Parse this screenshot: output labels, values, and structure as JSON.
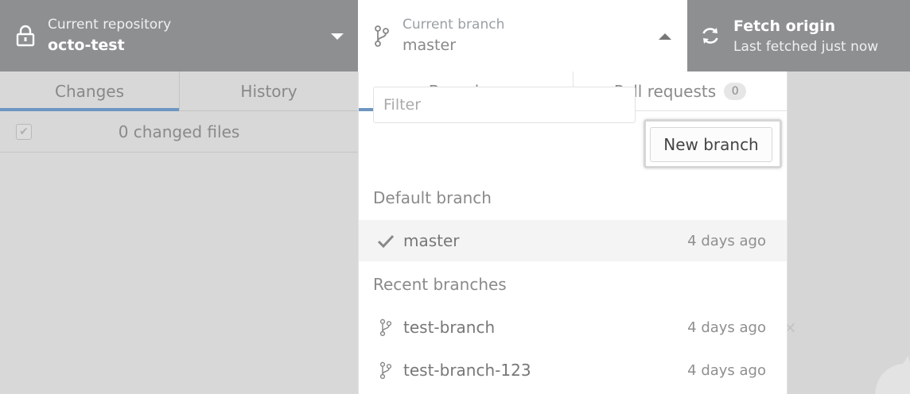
{
  "toolbar": {
    "repo": {
      "label": "Current repository",
      "value": "octo-test",
      "icon": "lock-icon"
    },
    "branch": {
      "label": "Current branch",
      "value": "master",
      "icon": "git-branch-icon"
    },
    "fetch": {
      "title": "Fetch origin",
      "subtitle": "Last fetched just now",
      "icon": "sync-icon"
    }
  },
  "left_pane": {
    "tabs": [
      {
        "label": "Changes",
        "active": true
      },
      {
        "label": "History",
        "active": false
      }
    ],
    "changed_files": "0 changed files"
  },
  "dropdown": {
    "tabs": [
      {
        "label": "Branches",
        "active": true
      },
      {
        "label": "Pull requests",
        "badge": "0",
        "active": false
      }
    ],
    "filter_placeholder": "Filter",
    "new_branch_label": "New branch",
    "default_section": "Default branch",
    "default_branch": {
      "name": "master",
      "time": "4 days ago",
      "icon": "check-icon"
    },
    "recent_section": "Recent branches",
    "recent_branches": [
      {
        "name": "test-branch",
        "time": "4 days ago",
        "icon": "git-branch-icon"
      },
      {
        "name": "test-branch-123",
        "time": "4 days ago",
        "icon": "git-branch-icon"
      }
    ]
  },
  "colors": {
    "toolbar_bg": "#8d8f91",
    "accent": "#6d96c1"
  }
}
